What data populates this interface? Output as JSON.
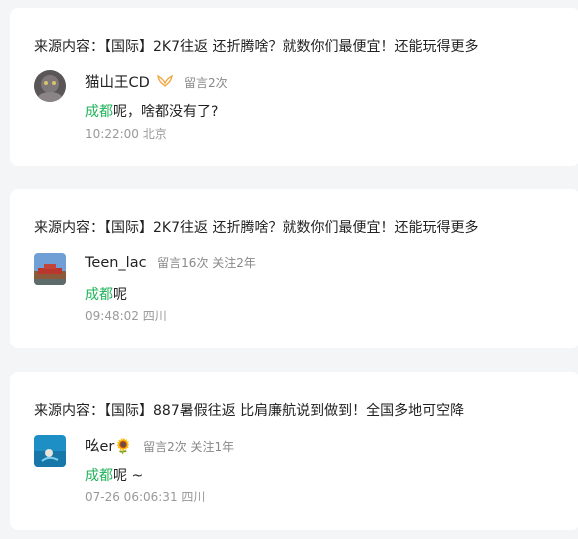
{
  "comments": [
    {
      "source": "来源内容：【国际】2K7往返 还折腾啥？就数你们最便宜！还能玩得更多",
      "username": "猫山王CD",
      "badge_icon": "vip-wings-icon",
      "meta": "留言2次",
      "keyword": "成都",
      "comment_rest": "呢，啥都没有了?",
      "time": "10:22:00 北京"
    },
    {
      "source": "来源内容：【国际】2K7往返 还折腾啥？就数你们最便宜！还能玩得更多",
      "username": "Teen_lac",
      "meta": "留言16次 关注2年",
      "keyword": "成都",
      "comment_rest": "呢",
      "time": "09:48:02 四川"
    },
    {
      "source": "来源内容：【国际】887暑假往返 比肩廉航说到做到！全国多地可空降",
      "username": "吆er",
      "username_emoji": "🌻",
      "meta": "留言2次 关注1年",
      "keyword": "成都",
      "comment_rest": "呢 ~",
      "time": "07-26 06:06:31 四川"
    }
  ],
  "colors": {
    "keyword": "#21b35a",
    "meta": "#888888",
    "background": "#f4f5f7"
  }
}
